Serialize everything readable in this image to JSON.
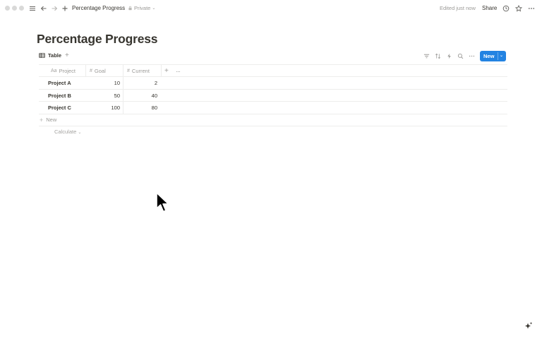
{
  "topbar": {
    "breadcrumb": "Percentage Progress",
    "privacy": "Private",
    "edited": "Edited just now",
    "share": "Share"
  },
  "page": {
    "title": "Percentage Progress"
  },
  "view": {
    "tab_label": "Table",
    "new_button": "New"
  },
  "table": {
    "columns": [
      {
        "label": "Project",
        "icon": "Aa"
      },
      {
        "label": "Goal",
        "icon": "#"
      },
      {
        "label": "Current",
        "icon": "#"
      }
    ],
    "rows": [
      {
        "project": "Project A",
        "goal": "10",
        "current": "2"
      },
      {
        "project": "Project B",
        "goal": "50",
        "current": "40"
      },
      {
        "project": "Project C",
        "goal": "100",
        "current": "80"
      }
    ],
    "new_row_label": "New",
    "calculate_label": "Calculate"
  },
  "colors": {
    "accent": "#2383e2",
    "text": "#37352f",
    "muted": "#9b9a97",
    "border": "#ededec"
  }
}
